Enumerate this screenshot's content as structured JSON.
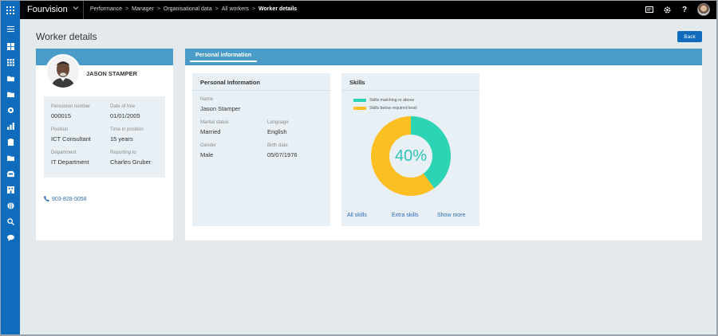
{
  "topbar": {
    "app_title": "Fourvision",
    "breadcrumbs": [
      "Performance",
      "Manager",
      "Organisational data",
      "All workers"
    ],
    "current_crumb": "Worker details",
    "icons": [
      "waffle-icon",
      "chevron-down-icon",
      "message-icon",
      "gear-icon",
      "help-icon",
      "user-avatar"
    ]
  },
  "leftnav": {
    "icons": [
      "hamburger-icon",
      "dashboard-icon",
      "apps-icon",
      "folder-icon",
      "folder-icon",
      "settings-icon",
      "chart-icon",
      "clipboard-icon",
      "folder-icon",
      "inbox-icon",
      "building-icon",
      "globe-icon",
      "search-icon",
      "chat-icon"
    ]
  },
  "page": {
    "title": "Worker details",
    "back_label": "Back"
  },
  "worker": {
    "name": "JASON STAMPER",
    "fields": [
      {
        "label": "Personnel number",
        "value": "000015"
      },
      {
        "label": "Date of hire",
        "value": "01/01/2005"
      },
      {
        "label": "Position",
        "value": "ICT Consultant"
      },
      {
        "label": "Time in position",
        "value": "15 years"
      },
      {
        "label": "Department",
        "value": "IT Department"
      },
      {
        "label": "Reporting to",
        "value": "Charles Gruber"
      }
    ],
    "phone": "903-828-5058"
  },
  "panel": {
    "tab_label": "Personal information"
  },
  "personal_info": {
    "title": "Personal Information",
    "fields": [
      {
        "label": "Name",
        "value": "Jason Stamper"
      },
      {
        "label": "Marital status",
        "value": "Married"
      },
      {
        "label": "Language",
        "value": "English"
      },
      {
        "label": "Gender",
        "value": "Male"
      },
      {
        "label": "Birth date",
        "value": "05/07/1976"
      }
    ]
  },
  "skills": {
    "title": "Skills",
    "legend": [
      {
        "label": "Skills matching or above",
        "color": "#2dd4b4"
      },
      {
        "label": "Skills below required level",
        "color": "#fbbf24"
      }
    ],
    "percent_label": "40%",
    "matching_fraction": 0.4,
    "links": [
      "All skills",
      "Extra skills",
      "Show more"
    ]
  }
}
